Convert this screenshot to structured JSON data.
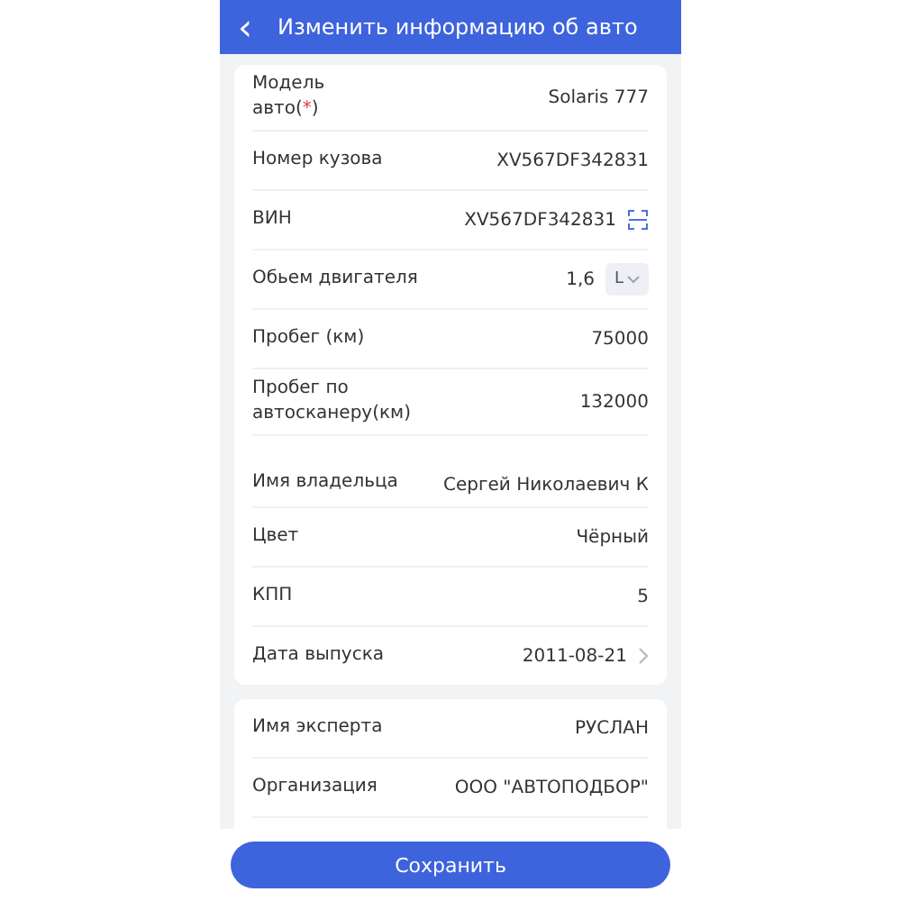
{
  "header": {
    "back": "‹",
    "title": "Изменить информацию об авто"
  },
  "car_fields": [
    {
      "kind": "required",
      "label": "Модель авто(",
      "required_mark": "*",
      "label_end": ")",
      "value": "Solaris 777"
    },
    {
      "kind": "text",
      "label": "Номер кузова",
      "value": "XV567DF342831"
    },
    {
      "kind": "scan",
      "label": "ВИН",
      "value": "XV567DF342831"
    },
    {
      "kind": "unit",
      "label": "Обьем двигателя",
      "value": "1,6",
      "unit": "L"
    },
    {
      "kind": "text",
      "label": "Пробег (км)",
      "value": "75000"
    },
    {
      "kind": "text",
      "label": "Пробег по автосканеру(км)",
      "value": "132000"
    },
    {
      "kind": "text",
      "label": "Имя владельца",
      "value": "Сергей Николаевич К"
    },
    {
      "kind": "text",
      "label": "Цвет",
      "value": "Чёрный"
    },
    {
      "kind": "text",
      "label": "КПП",
      "value": "5"
    },
    {
      "kind": "date",
      "label": "Дата выпуска",
      "value": "2011-08-21"
    }
  ],
  "expert_fields": [
    {
      "label": "Имя эксперта",
      "value": "РУСЛАН"
    },
    {
      "label": "Организация",
      "value": "ООО \"АВТОПОДБОР\""
    }
  ],
  "save_button": "Сохранить"
}
